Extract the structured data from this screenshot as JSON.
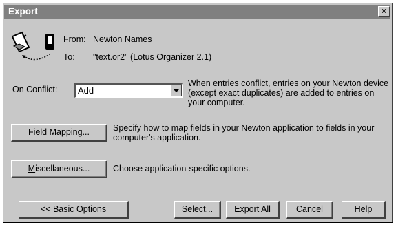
{
  "dialog": {
    "title": "Export",
    "close_glyph": "×"
  },
  "header": {
    "from_label": "From:",
    "from_value": "Newton Names",
    "to_label": "To:",
    "to_value": "\"text.or2\" (Lotus Organizer 2.1)"
  },
  "conflict": {
    "label": "On Conflict:",
    "selected": "Add",
    "description": "When entries conflict, entries on your Newton device (except exact duplicates) are added to entries on your computer."
  },
  "field_mapping": {
    "button_pre": "Field Ma",
    "button_mn": "p",
    "button_post": "ping...",
    "description": "Specify how to map fields in your Newton application to fields in your computer's application."
  },
  "miscellaneous": {
    "button_mn": "M",
    "button_post": "iscellaneous...",
    "description": "Choose application-specific options."
  },
  "buttons": {
    "basic_pre": "<< Basic ",
    "basic_mn": "O",
    "basic_post": "ptions",
    "select_mn": "S",
    "select_post": "elect...",
    "export_mn": "E",
    "export_post": "xport All",
    "cancel": "Cancel",
    "help_mn": "H",
    "help_post": "elp"
  },
  "icons": [
    "document-icon",
    "newton-device-icon",
    "transfer-arrow-icon",
    "dropdown-arrow-icon",
    "close-icon"
  ]
}
